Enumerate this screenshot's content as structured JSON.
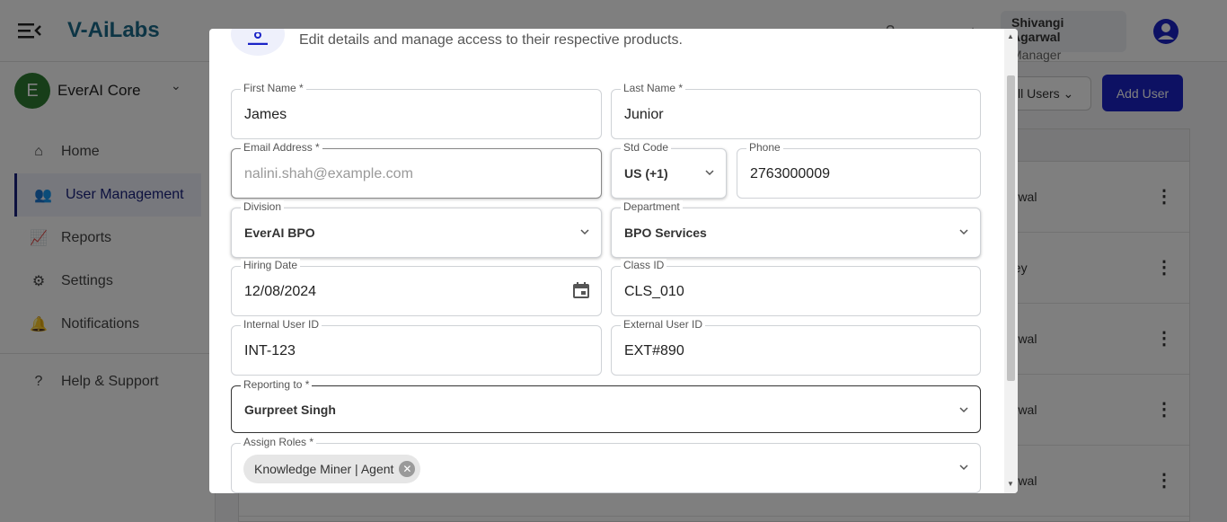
{
  "app": {
    "logo_text": "V-AiLabs",
    "user_name": "Shivangi Agarwal",
    "user_role": "Manager"
  },
  "sidebar": {
    "org_initial": "E",
    "org_name": "EverAI Core",
    "items": [
      {
        "label": "Home",
        "icon": "home-icon"
      },
      {
        "label": "User Management",
        "icon": "users-icon",
        "active": true
      },
      {
        "label": "Reports",
        "icon": "chart-icon"
      },
      {
        "label": "Settings",
        "icon": "gear-icon"
      },
      {
        "label": "Notifications",
        "icon": "bell-icon"
      }
    ],
    "help_label": "Help & Support"
  },
  "main": {
    "filter_label": "ll Users",
    "add_user_label": "Add User",
    "rows": [
      "arwal",
      "dey",
      "arwal",
      "arwal",
      "arwal"
    ]
  },
  "modal": {
    "subtitle": "Edit details and manage access to their respective products.",
    "fields": {
      "first_name": {
        "label": "First Name *",
        "value": "James"
      },
      "last_name": {
        "label": "Last Name *",
        "value": "Junior"
      },
      "email": {
        "label": "Email Address *",
        "placeholder": "nalini.shah@example.com"
      },
      "std_code": {
        "label": "Std Code",
        "value": "US (+1)"
      },
      "phone": {
        "label": "Phone",
        "value": "2763000009"
      },
      "division": {
        "label": "Division",
        "value": "EverAI BPO"
      },
      "department": {
        "label": "Department",
        "value": "BPO Services"
      },
      "hiring_date": {
        "label": "Hiring Date",
        "value": "12/08/2024"
      },
      "class_id": {
        "label": "Class ID",
        "value": "CLS_010"
      },
      "internal_id": {
        "label": "Internal User ID",
        "value": "INT-123"
      },
      "external_id": {
        "label": "External User ID",
        "value": "EXT#890"
      },
      "reporting_to": {
        "label": "Reporting to *",
        "value": "Gurpreet Singh"
      },
      "roles": {
        "label": "Assign Roles *",
        "chips": [
          "Knowledge Miner | Agent"
        ]
      }
    }
  }
}
